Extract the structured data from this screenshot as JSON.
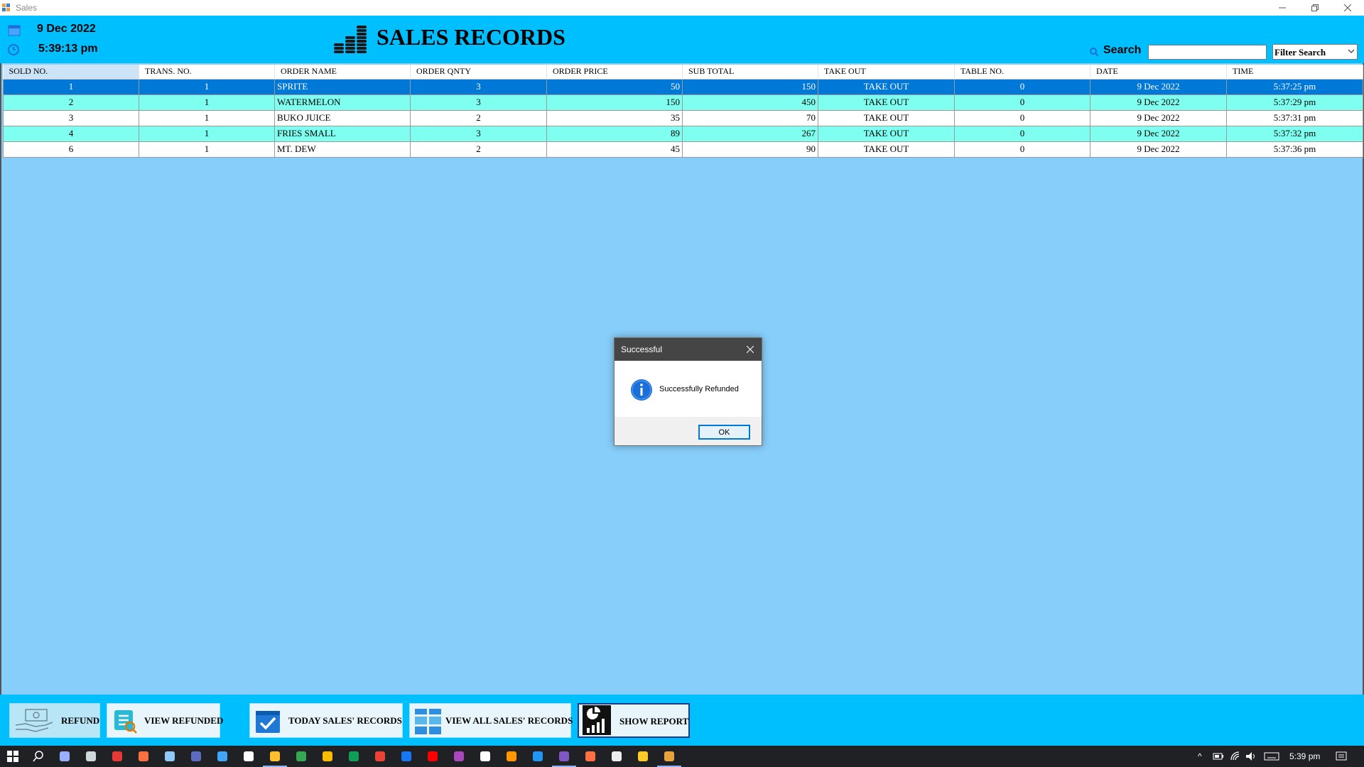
{
  "window": {
    "title": "Sales",
    "minimize": "—",
    "restore": "❐",
    "close": "✕"
  },
  "header": {
    "date": "9 Dec 2022",
    "time": "5:39:13 pm",
    "title": "SALES RECORDS",
    "search_label": "Search",
    "search_value": "",
    "filter_label": "Filter Search"
  },
  "table": {
    "columns": [
      "SOLD NO.",
      "TRANS. NO.",
      "ORDER NAME",
      "ORDER QNTY",
      "ORDER PRICE",
      "SUB TOTAL",
      "TAKE OUT",
      "TABLE NO.",
      "DATE",
      "TIME"
    ],
    "rows": [
      [
        "1",
        "1",
        "SPRITE",
        "3",
        "50",
        "150",
        "TAKE OUT",
        "0",
        "9 Dec 2022",
        "5:37:25 pm"
      ],
      [
        "2",
        "1",
        "WATERMELON",
        "3",
        "150",
        "450",
        "TAKE OUT",
        "0",
        "9 Dec 2022",
        "5:37:29 pm"
      ],
      [
        "3",
        "1",
        "BUKO JUICE",
        "2",
        "35",
        "70",
        "TAKE OUT",
        "0",
        "9 Dec 2022",
        "5:37:31 pm"
      ],
      [
        "4",
        "1",
        "FRIES SMALL",
        "3",
        "89",
        "267",
        "TAKE OUT",
        "0",
        "9 Dec 2022",
        "5:37:32 pm"
      ],
      [
        "6",
        "1",
        "MT. DEW",
        "2",
        "45",
        "90",
        "TAKE OUT",
        "0",
        "9 Dec 2022",
        "5:37:36 pm"
      ]
    ],
    "selected_row": 0
  },
  "dialog": {
    "title": "Successful",
    "message": "Successfully Refunded",
    "ok_label": "OK"
  },
  "bottom_buttons": {
    "refund": "REFUND",
    "view_refunded": "VIEW REFUNDED",
    "today_sales": "TODAY SALES' RECORDS",
    "view_all_sales": "VIEW ALL SALES' RECORDS",
    "show_report": "SHOW REPORT"
  },
  "taskbar": {
    "clock": "5:39 pm"
  },
  "colors": {
    "header_bg": "#00bfff",
    "grid_bg": "#87cefa",
    "row_alt": "#7ffff0",
    "row_selected": "#0078d7"
  }
}
